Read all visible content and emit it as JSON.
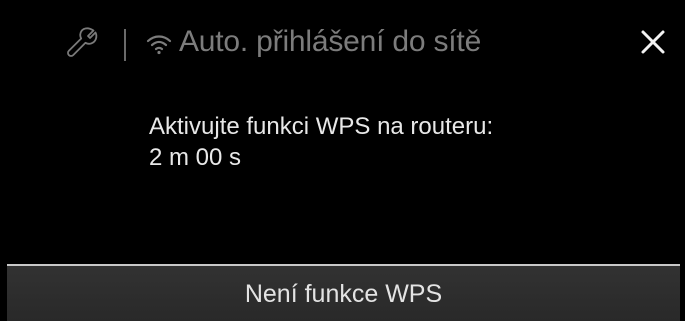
{
  "header": {
    "settings_icon": "wrench-icon",
    "wifi_icon": "wifi-icon",
    "title": "Auto. přihlášení do sítě",
    "close_icon": "close-icon"
  },
  "message": {
    "instruction": "Aktivujte funkci WPS na routeru:",
    "countdown": "2 m 00 s"
  },
  "footer": {
    "no_wps_button_label": "Není funkce WPS"
  },
  "colors": {
    "background": "#000000",
    "title_text": "#7c7c7c",
    "body_text": "#e8e8e8",
    "button_background": "#2e2e2e",
    "button_border": "#c8c8c8"
  }
}
